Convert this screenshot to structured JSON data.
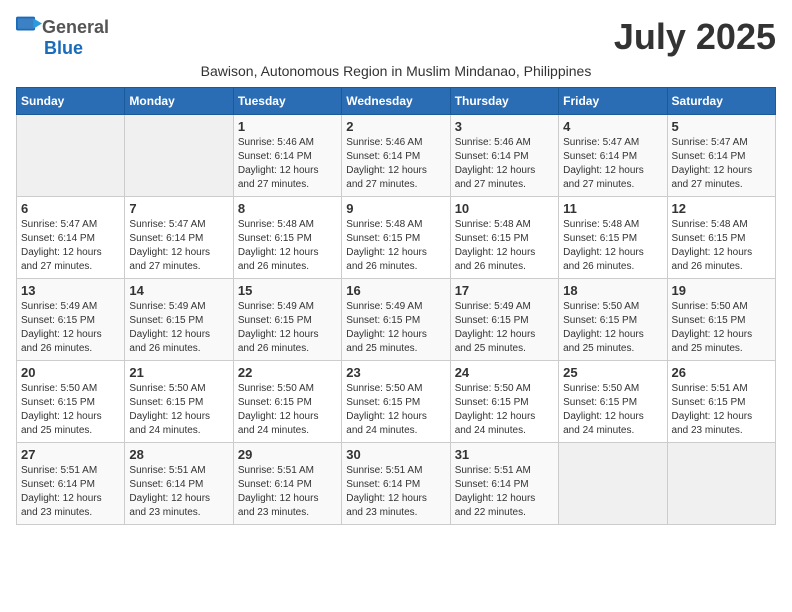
{
  "header": {
    "logo_general": "General",
    "logo_blue": "Blue",
    "month_title": "July 2025",
    "subtitle": "Bawison, Autonomous Region in Muslim Mindanao, Philippines"
  },
  "days_of_week": [
    "Sunday",
    "Monday",
    "Tuesday",
    "Wednesday",
    "Thursday",
    "Friday",
    "Saturday"
  ],
  "weeks": [
    [
      {
        "day": "",
        "sunrise": "",
        "sunset": "",
        "daylight": ""
      },
      {
        "day": "",
        "sunrise": "",
        "sunset": "",
        "daylight": ""
      },
      {
        "day": "1",
        "sunrise": "Sunrise: 5:46 AM",
        "sunset": "Sunset: 6:14 PM",
        "daylight": "Daylight: 12 hours and 27 minutes."
      },
      {
        "day": "2",
        "sunrise": "Sunrise: 5:46 AM",
        "sunset": "Sunset: 6:14 PM",
        "daylight": "Daylight: 12 hours and 27 minutes."
      },
      {
        "day": "3",
        "sunrise": "Sunrise: 5:46 AM",
        "sunset": "Sunset: 6:14 PM",
        "daylight": "Daylight: 12 hours and 27 minutes."
      },
      {
        "day": "4",
        "sunrise": "Sunrise: 5:47 AM",
        "sunset": "Sunset: 6:14 PM",
        "daylight": "Daylight: 12 hours and 27 minutes."
      },
      {
        "day": "5",
        "sunrise": "Sunrise: 5:47 AM",
        "sunset": "Sunset: 6:14 PM",
        "daylight": "Daylight: 12 hours and 27 minutes."
      }
    ],
    [
      {
        "day": "6",
        "sunrise": "Sunrise: 5:47 AM",
        "sunset": "Sunset: 6:14 PM",
        "daylight": "Daylight: 12 hours and 27 minutes."
      },
      {
        "day": "7",
        "sunrise": "Sunrise: 5:47 AM",
        "sunset": "Sunset: 6:14 PM",
        "daylight": "Daylight: 12 hours and 27 minutes."
      },
      {
        "day": "8",
        "sunrise": "Sunrise: 5:48 AM",
        "sunset": "Sunset: 6:15 PM",
        "daylight": "Daylight: 12 hours and 26 minutes."
      },
      {
        "day": "9",
        "sunrise": "Sunrise: 5:48 AM",
        "sunset": "Sunset: 6:15 PM",
        "daylight": "Daylight: 12 hours and 26 minutes."
      },
      {
        "day": "10",
        "sunrise": "Sunrise: 5:48 AM",
        "sunset": "Sunset: 6:15 PM",
        "daylight": "Daylight: 12 hours and 26 minutes."
      },
      {
        "day": "11",
        "sunrise": "Sunrise: 5:48 AM",
        "sunset": "Sunset: 6:15 PM",
        "daylight": "Daylight: 12 hours and 26 minutes."
      },
      {
        "day": "12",
        "sunrise": "Sunrise: 5:48 AM",
        "sunset": "Sunset: 6:15 PM",
        "daylight": "Daylight: 12 hours and 26 minutes."
      }
    ],
    [
      {
        "day": "13",
        "sunrise": "Sunrise: 5:49 AM",
        "sunset": "Sunset: 6:15 PM",
        "daylight": "Daylight: 12 hours and 26 minutes."
      },
      {
        "day": "14",
        "sunrise": "Sunrise: 5:49 AM",
        "sunset": "Sunset: 6:15 PM",
        "daylight": "Daylight: 12 hours and 26 minutes."
      },
      {
        "day": "15",
        "sunrise": "Sunrise: 5:49 AM",
        "sunset": "Sunset: 6:15 PM",
        "daylight": "Daylight: 12 hours and 26 minutes."
      },
      {
        "day": "16",
        "sunrise": "Sunrise: 5:49 AM",
        "sunset": "Sunset: 6:15 PM",
        "daylight": "Daylight: 12 hours and 25 minutes."
      },
      {
        "day": "17",
        "sunrise": "Sunrise: 5:49 AM",
        "sunset": "Sunset: 6:15 PM",
        "daylight": "Daylight: 12 hours and 25 minutes."
      },
      {
        "day": "18",
        "sunrise": "Sunrise: 5:50 AM",
        "sunset": "Sunset: 6:15 PM",
        "daylight": "Daylight: 12 hours and 25 minutes."
      },
      {
        "day": "19",
        "sunrise": "Sunrise: 5:50 AM",
        "sunset": "Sunset: 6:15 PM",
        "daylight": "Daylight: 12 hours and 25 minutes."
      }
    ],
    [
      {
        "day": "20",
        "sunrise": "Sunrise: 5:50 AM",
        "sunset": "Sunset: 6:15 PM",
        "daylight": "Daylight: 12 hours and 25 minutes."
      },
      {
        "day": "21",
        "sunrise": "Sunrise: 5:50 AM",
        "sunset": "Sunset: 6:15 PM",
        "daylight": "Daylight: 12 hours and 24 minutes."
      },
      {
        "day": "22",
        "sunrise": "Sunrise: 5:50 AM",
        "sunset": "Sunset: 6:15 PM",
        "daylight": "Daylight: 12 hours and 24 minutes."
      },
      {
        "day": "23",
        "sunrise": "Sunrise: 5:50 AM",
        "sunset": "Sunset: 6:15 PM",
        "daylight": "Daylight: 12 hours and 24 minutes."
      },
      {
        "day": "24",
        "sunrise": "Sunrise: 5:50 AM",
        "sunset": "Sunset: 6:15 PM",
        "daylight": "Daylight: 12 hours and 24 minutes."
      },
      {
        "day": "25",
        "sunrise": "Sunrise: 5:50 AM",
        "sunset": "Sunset: 6:15 PM",
        "daylight": "Daylight: 12 hours and 24 minutes."
      },
      {
        "day": "26",
        "sunrise": "Sunrise: 5:51 AM",
        "sunset": "Sunset: 6:15 PM",
        "daylight": "Daylight: 12 hours and 23 minutes."
      }
    ],
    [
      {
        "day": "27",
        "sunrise": "Sunrise: 5:51 AM",
        "sunset": "Sunset: 6:14 PM",
        "daylight": "Daylight: 12 hours and 23 minutes."
      },
      {
        "day": "28",
        "sunrise": "Sunrise: 5:51 AM",
        "sunset": "Sunset: 6:14 PM",
        "daylight": "Daylight: 12 hours and 23 minutes."
      },
      {
        "day": "29",
        "sunrise": "Sunrise: 5:51 AM",
        "sunset": "Sunset: 6:14 PM",
        "daylight": "Daylight: 12 hours and 23 minutes."
      },
      {
        "day": "30",
        "sunrise": "Sunrise: 5:51 AM",
        "sunset": "Sunset: 6:14 PM",
        "daylight": "Daylight: 12 hours and 23 minutes."
      },
      {
        "day": "31",
        "sunrise": "Sunrise: 5:51 AM",
        "sunset": "Sunset: 6:14 PM",
        "daylight": "Daylight: 12 hours and 22 minutes."
      },
      {
        "day": "",
        "sunrise": "",
        "sunset": "",
        "daylight": ""
      },
      {
        "day": "",
        "sunrise": "",
        "sunset": "",
        "daylight": ""
      }
    ]
  ]
}
